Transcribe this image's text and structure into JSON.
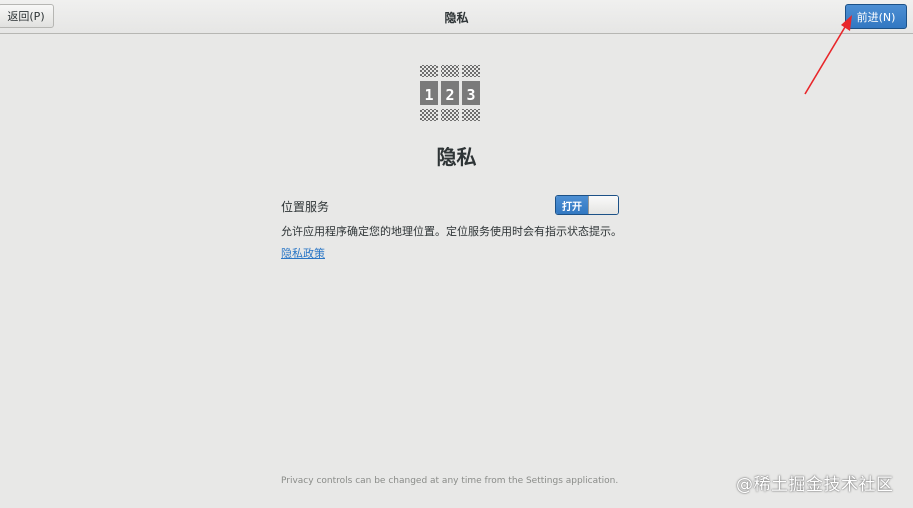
{
  "header": {
    "title": "隐私",
    "back_label": "返回(P)",
    "next_label": "前进(N)"
  },
  "page": {
    "heading": "隐私",
    "logo_digits": [
      "1",
      "2",
      "3"
    ],
    "location": {
      "label": "位置服务",
      "toggle_state_label": "打开",
      "enabled": true,
      "description": "允许应用程序确定您的地理位置。定位服务使用时会有指示状态提示。"
    },
    "policy_link": "隐私政策",
    "footer_note": "Privacy controls can be changed at any time from the Settings application."
  },
  "watermark": "@稀土掘金技术社区",
  "colors": {
    "accent": "#3278c2",
    "background": "#e8e8e7",
    "annotation_arrow": "#e8262a",
    "link": "#2a76c6"
  },
  "icons": {
    "logo": "privacy-123-logo-icon",
    "annotation": "red-arrow-annotation"
  }
}
